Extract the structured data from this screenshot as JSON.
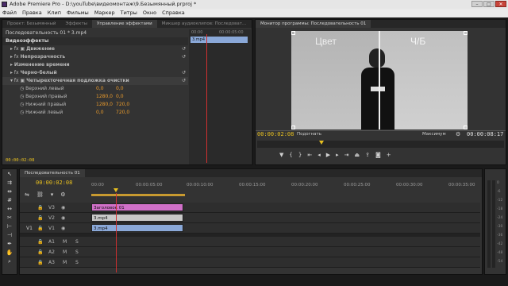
{
  "window": {
    "title": "Adobe Premiere Pro - D:\\youTube\\видеомонтаж\\9.Безымянный.prproj *",
    "buttons": [
      "–",
      "□",
      "✕"
    ]
  },
  "menu": [
    "Файл",
    "Правка",
    "Клип",
    "Фильмы",
    "Маркер",
    "Титры",
    "Окно",
    "Справка"
  ],
  "effects_panel": {
    "tabs": [
      "Проект: Безымянный",
      "Эффекты",
      "Управление эффектами",
      "Микшер аудиоклипов: Последоват..."
    ],
    "header": "Последовательность 01 * 3.mp4",
    "mini_clip": "3.mp4",
    "mini_time": "00:00:05:00",
    "mini_time0": "00:00",
    "section": "Видеоэффекты",
    "effects": [
      "Движение",
      "Непрозрачность",
      "Изменение времени",
      "Черно-белый",
      "Четырехточечная подложка очистки"
    ],
    "params": [
      {
        "label": "Верхний левый",
        "x": "0,0",
        "y": "0,0"
      },
      {
        "label": "Верхний правый",
        "x": "1280,0",
        "y": "0,0"
      },
      {
        "label": "Нижний правый",
        "x": "1280,0",
        "y": "720,0"
      },
      {
        "label": "Нижний левый",
        "x": "0,0",
        "y": "720,0"
      }
    ],
    "timecode": "00:00:02:08"
  },
  "program_monitor": {
    "tab": "Монитор программы: Последовательность 01",
    "overlay_left": "Цвет",
    "overlay_right": "Ч/Б",
    "timecode": "00:00:02:08",
    "fit": "Подогнать",
    "quality": "Максимум",
    "duration": "00:00:08:17"
  },
  "timeline": {
    "tab": "Последовательность 01",
    "timecode": "00:00:02:08",
    "ruler": [
      "00:00",
      "00:00:05:00",
      "00:00:10:00",
      "00:00:15:00",
      "00:00:20:00",
      "00:00:25:00",
      "00:00:30:00",
      "00:00:35:00"
    ],
    "tracks": [
      {
        "name": "V3",
        "src": ""
      },
      {
        "name": "V2",
        "src": ""
      },
      {
        "name": "V1",
        "src": "V1"
      },
      {
        "name": "A1",
        "src": ""
      },
      {
        "name": "A2",
        "src": ""
      },
      {
        "name": "A3",
        "src": ""
      }
    ],
    "clips": {
      "title": "Заголовок 01",
      "v2": "3.mp4",
      "v1": "3.mp4"
    },
    "colors": {
      "title_clip": "#d070c8",
      "v2_clip": "#c8c8c8",
      "v1_clip": "#8aa8d8",
      "playhead": "#d03030"
    }
  },
  "meter": {
    "labels": [
      "0",
      "-6",
      "-12",
      "-18",
      "-24",
      "-30",
      "-36",
      "-42",
      "-48",
      "-54"
    ]
  }
}
